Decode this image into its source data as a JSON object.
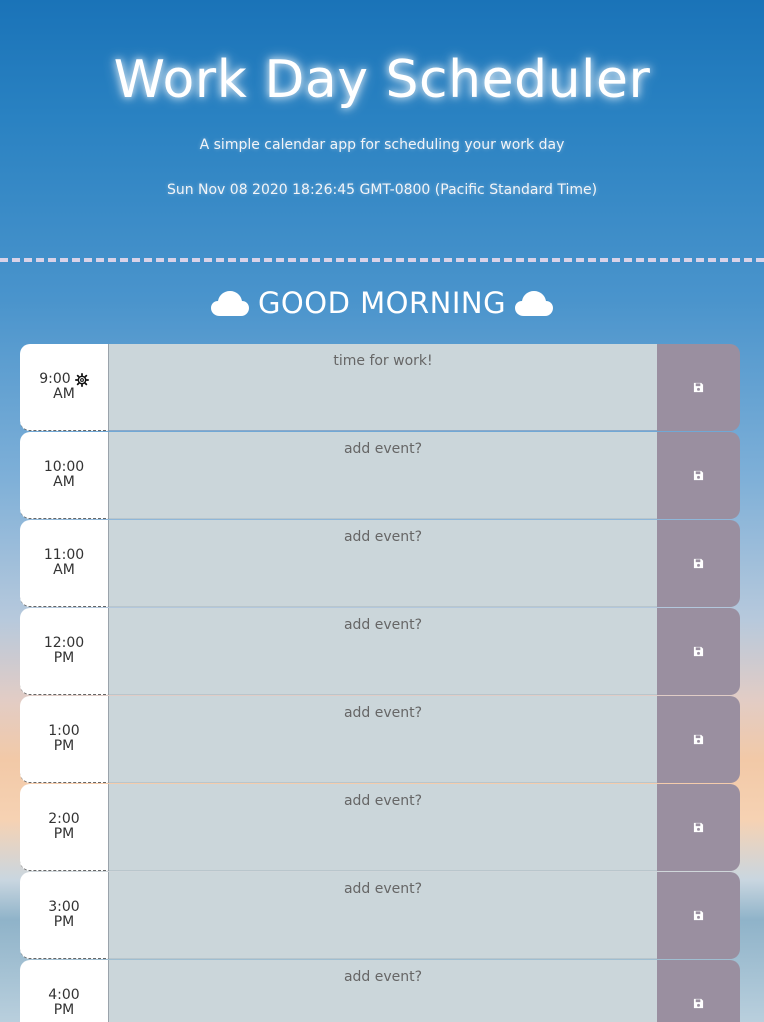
{
  "header": {
    "title": "Work Day Scheduler",
    "subtitle": "A simple calendar app for scheduling your work day",
    "datetime": "Sun Nov 08 2020 18:26:45 GMT-0800 (Pacific Standard Time)"
  },
  "greeting": {
    "text": "GOOD MORNING",
    "icon": "cloud-icon"
  },
  "schedule": {
    "rows": [
      {
        "hour": "9:00",
        "period": "AM",
        "event": "time for work!",
        "has_gear": true
      },
      {
        "hour": "10:00",
        "period": "AM",
        "event": "add event?"
      },
      {
        "hour": "11:00",
        "period": "AM",
        "event": "add event?"
      },
      {
        "hour": "12:00",
        "period": "PM",
        "event": "add event?"
      },
      {
        "hour": "1:00",
        "period": "PM",
        "event": "add event?"
      },
      {
        "hour": "2:00",
        "period": "PM",
        "event": "add event?"
      },
      {
        "hour": "3:00",
        "period": "PM",
        "event": "add event?"
      },
      {
        "hour": "4:00",
        "period": "PM",
        "event": "add event?"
      }
    ],
    "save_icon": "save-icon"
  },
  "colors": {
    "event_bg": "#cbd6da",
    "save_bg": "#9a8fa0",
    "divider": "#d9d2e8"
  }
}
